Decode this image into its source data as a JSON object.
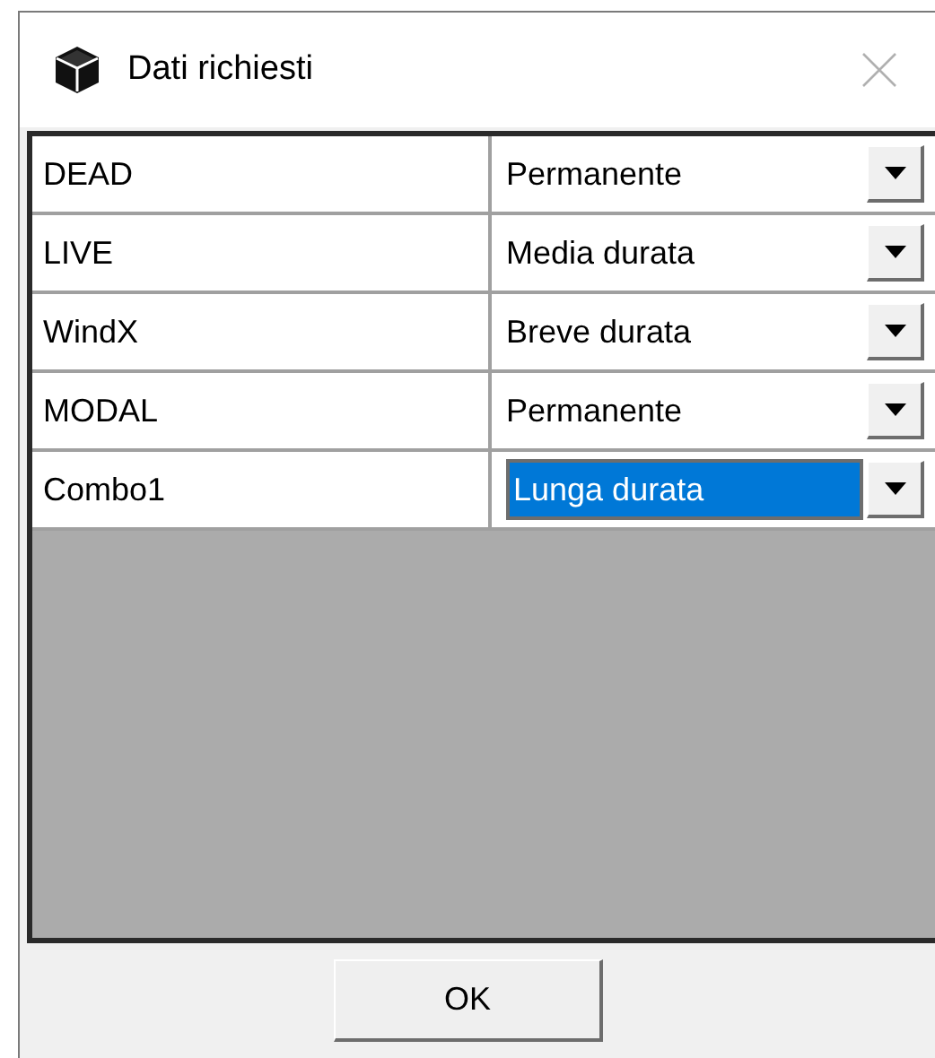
{
  "window": {
    "title": "Dati richiesti"
  },
  "rows": [
    {
      "name": "DEAD",
      "value": "Permanente",
      "selected": false
    },
    {
      "name": "LIVE",
      "value": "Media durata",
      "selected": false
    },
    {
      "name": "WindX",
      "value": "Breve durata",
      "selected": false
    },
    {
      "name": "MODAL",
      "value": "Permanente",
      "selected": false
    },
    {
      "name": "Combo1",
      "value": "Lunga durata",
      "selected": true
    }
  ],
  "buttons": [
    "OK"
  ]
}
